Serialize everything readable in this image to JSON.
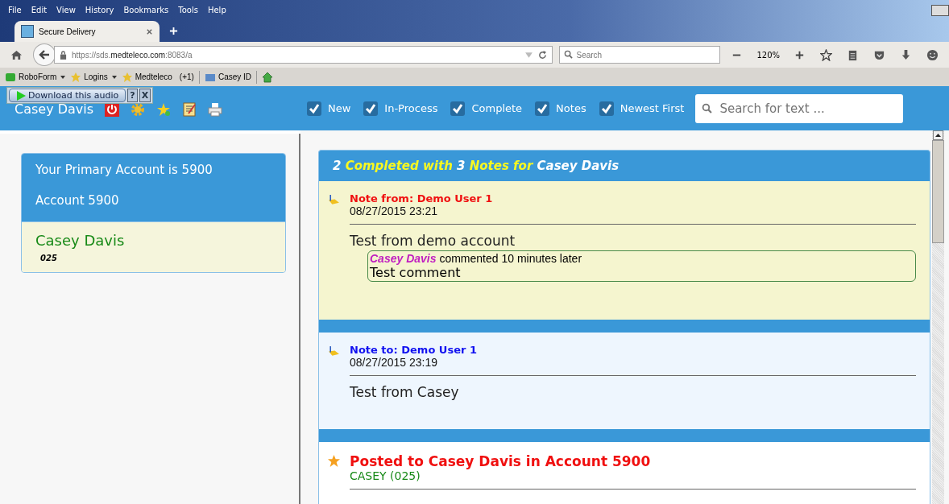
{
  "browser": {
    "menu": [
      "File",
      "Edit",
      "View",
      "History",
      "Bookmarks",
      "Tools",
      "Help"
    ],
    "tab": {
      "title": "Secure Delivery",
      "selected": true
    },
    "url": {
      "prefix": "https://sds.",
      "domain": "medteleco.com",
      "suffix": ":8083/a"
    },
    "search": {
      "placeholder": "Search"
    },
    "zoom": "120%",
    "bookmarks": [
      {
        "label": "RoboForm",
        "dropdown": true
      },
      {
        "label": "Logins",
        "dropdown": true
      },
      {
        "label": "Medteleco",
        "dropdown": false,
        "count": "(+1)"
      },
      {
        "label": "Casey ID",
        "dropdown": false
      }
    ]
  },
  "audio_bar": {
    "label": "Download this audio",
    "help": "?",
    "close": "X"
  },
  "header": {
    "title": "Casey Davis",
    "filters": [
      {
        "label": "New",
        "checked": true
      },
      {
        "label": "In-Process",
        "checked": true
      },
      {
        "label": "Complete",
        "checked": true
      },
      {
        "label": "Notes",
        "checked": true
      },
      {
        "label": "Newest First",
        "checked": true
      }
    ],
    "search": {
      "placeholder": "Search for text ..."
    }
  },
  "account_card": {
    "primary": "Your Primary Account is 5900",
    "account": "Account 5900",
    "name": "Casey Davis",
    "code": "025"
  },
  "feed": {
    "summary": [
      {
        "text": "2",
        "highlight": false
      },
      {
        "text": "Completed with",
        "highlight": true
      },
      {
        "text": "3",
        "highlight": false
      },
      {
        "text": "Notes for",
        "highlight": true
      },
      {
        "text": "Casey Davis",
        "highlight": false
      }
    ],
    "items": [
      {
        "kind": "note_from",
        "title": "Note from: Demo User 1",
        "date": "08/27/2015 23:21",
        "body": "Test from demo account",
        "comments": [
          {
            "author": "Casey Davis",
            "meta": "commented 10 minutes later",
            "text": "Test comment"
          }
        ]
      },
      {
        "kind": "note_to",
        "title": "Note to: Demo User 1",
        "date": "08/27/2015 23:19",
        "body": "Test from Casey"
      },
      {
        "kind": "posted",
        "title": "Posted to Casey Davis in Account 5900",
        "subtitle": "CASEY (025)"
      }
    ]
  }
}
